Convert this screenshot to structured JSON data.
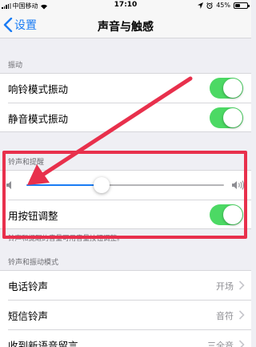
{
  "status_bar": {
    "carrier": "中国移动",
    "time": "17:10",
    "battery": "45%",
    "battery_level": 0.45
  },
  "nav": {
    "back_label": "设置",
    "title": "声音与触感"
  },
  "vibrate_section": {
    "header": "振动",
    "rows": [
      {
        "label": "响铃模式振动",
        "on": true
      },
      {
        "label": "静音模式振动",
        "on": true
      }
    ]
  },
  "ringer_section": {
    "header": "铃声和提醒",
    "volume_level": 0.38,
    "change_with_buttons": {
      "label": "用按钮调整",
      "on": true
    },
    "footer": "铃声和提醒的音量可用音量按钮调整。"
  },
  "patterns_section": {
    "header": "铃声和振动模式",
    "rows": [
      {
        "label": "电话铃声",
        "value": "开场"
      },
      {
        "label": "短信铃声",
        "value": "音符"
      },
      {
        "label": "收到新语音留言",
        "value": "三全音"
      }
    ]
  },
  "colors": {
    "accent": "#1a7cf4",
    "toggle_on": "#4cd964",
    "annotation": "#e8304c"
  },
  "icons": [
    "wifi-icon",
    "location-icon",
    "alarm-icon",
    "chevron-left-icon",
    "volume-low-icon",
    "volume-high-icon",
    "chevron-right-icon"
  ]
}
